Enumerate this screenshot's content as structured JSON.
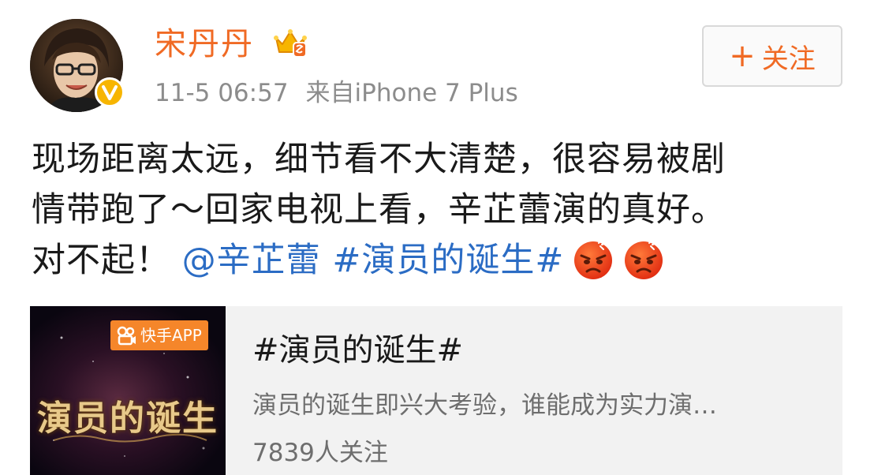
{
  "post": {
    "author": {
      "name": "宋丹丹",
      "avatar_icon": "avatar-photo",
      "verified_icon": "verified-v-icon",
      "vip_icon": "crown-vip-icon"
    },
    "meta": {
      "time": "11-5 06:57",
      "source": "来自iPhone 7 Plus"
    },
    "follow_button": {
      "plus": "+",
      "label": "关注"
    },
    "content": {
      "line1": "现场距离太远，细节看不大清楚，很容易被剧",
      "line2": "情带跑了～回家电视上看，辛芷蕾演的真好。",
      "line3_text": "对不起！",
      "mention": "@辛芷蕾",
      "topic": "#演员的诞生#",
      "emoji": "angry-face-emoji"
    },
    "card": {
      "app_badge": "快手APP",
      "thumb_logo": "演员的诞生",
      "title": "#演员的诞生#",
      "description": "演员的诞生即兴大考验，谁能成为实力演…",
      "followers": "7839人关注"
    }
  },
  "colors": {
    "accent_orange": "#f06a24",
    "link_blue": "#2b6cc4",
    "meta_gray": "#8c8c8c",
    "card_bg": "#f2f2f2",
    "verified_yellow": "#f7b500"
  }
}
